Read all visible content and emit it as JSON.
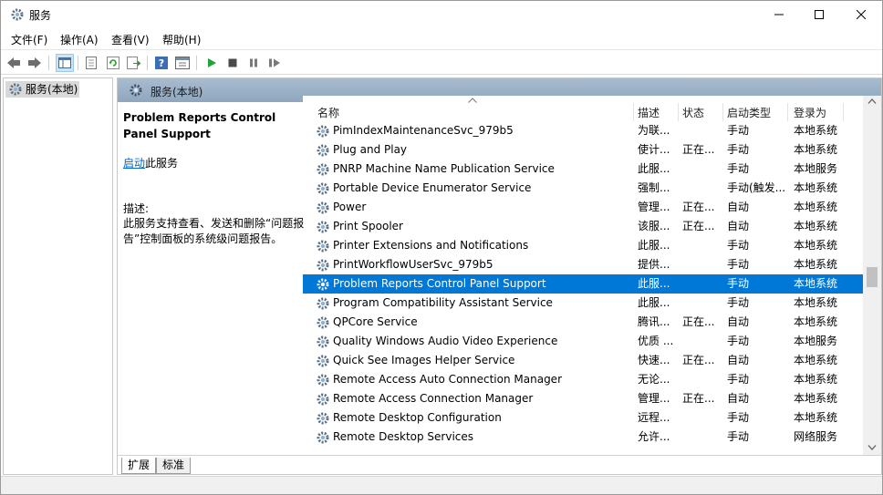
{
  "window": {
    "title": "服务"
  },
  "menu": [
    "文件(F)",
    "操作(A)",
    "查看(V)",
    "帮助(H)"
  ],
  "tree": {
    "root_label": "服务(本地)"
  },
  "panel": {
    "header_title": "服务(本地)"
  },
  "description": {
    "service_title": "Problem Reports Control Panel Support",
    "action_link": "启动",
    "action_suffix": "此服务",
    "label": "描述:",
    "text": "此服务支持查看、发送和删除“问题报告”控制面板的系统级问题报告。"
  },
  "columns": {
    "name": "名称",
    "description": "描述",
    "status": "状态",
    "startup": "启动类型",
    "logon": "登录为"
  },
  "services": [
    {
      "name": "PimIndexMaintenanceSvc_979b5",
      "description": "为联...",
      "status": "",
      "startup": "手动",
      "logon": "本地系统"
    },
    {
      "name": "Plug and Play",
      "description": "使计...",
      "status": "正在...",
      "startup": "手动",
      "logon": "本地系统"
    },
    {
      "name": "PNRP Machine Name Publication Service",
      "description": "此服...",
      "status": "",
      "startup": "手动",
      "logon": "本地服务"
    },
    {
      "name": "Portable Device Enumerator Service",
      "description": "强制...",
      "status": "",
      "startup": "手动(触发...",
      "logon": "本地系统"
    },
    {
      "name": "Power",
      "description": "管理...",
      "status": "正在...",
      "startup": "自动",
      "logon": "本地系统"
    },
    {
      "name": "Print Spooler",
      "description": "该服...",
      "status": "正在...",
      "startup": "自动",
      "logon": "本地系统"
    },
    {
      "name": "Printer Extensions and Notifications",
      "description": "此服...",
      "status": "",
      "startup": "手动",
      "logon": "本地系统"
    },
    {
      "name": "PrintWorkflowUserSvc_979b5",
      "description": "提供...",
      "status": "",
      "startup": "手动",
      "logon": "本地系统"
    },
    {
      "name": "Problem Reports Control Panel Support",
      "description": "此服...",
      "status": "",
      "startup": "手动",
      "logon": "本地系统",
      "selected": true
    },
    {
      "name": "Program Compatibility Assistant Service",
      "description": "此服...",
      "status": "",
      "startup": "手动",
      "logon": "本地系统"
    },
    {
      "name": "QPCore Service",
      "description": "腾讯...",
      "status": "正在...",
      "startup": "自动",
      "logon": "本地系统"
    },
    {
      "name": "Quality Windows Audio Video Experience",
      "description": "优质 ...",
      "status": "",
      "startup": "手动",
      "logon": "本地服务"
    },
    {
      "name": "Quick See Images Helper Service",
      "description": "快速...",
      "status": "正在...",
      "startup": "自动",
      "logon": "本地系统"
    },
    {
      "name": "Remote Access Auto Connection Manager",
      "description": "无论...",
      "status": "",
      "startup": "手动",
      "logon": "本地系统"
    },
    {
      "name": "Remote Access Connection Manager",
      "description": "管理...",
      "status": "正在...",
      "startup": "自动",
      "logon": "本地系统"
    },
    {
      "name": "Remote Desktop Configuration",
      "description": "远程...",
      "status": "",
      "startup": "手动",
      "logon": "本地系统"
    },
    {
      "name": "Remote Desktop Services",
      "description": "允许...",
      "status": "",
      "startup": "手动",
      "logon": "网络服务"
    }
  ],
  "tabs": {
    "extended": "扩展",
    "standard": "标准"
  },
  "colors": {
    "selection": "#0078d7",
    "header_gradient_top": "#a9bcd0",
    "header_gradient_bottom": "#8fa6bd"
  }
}
